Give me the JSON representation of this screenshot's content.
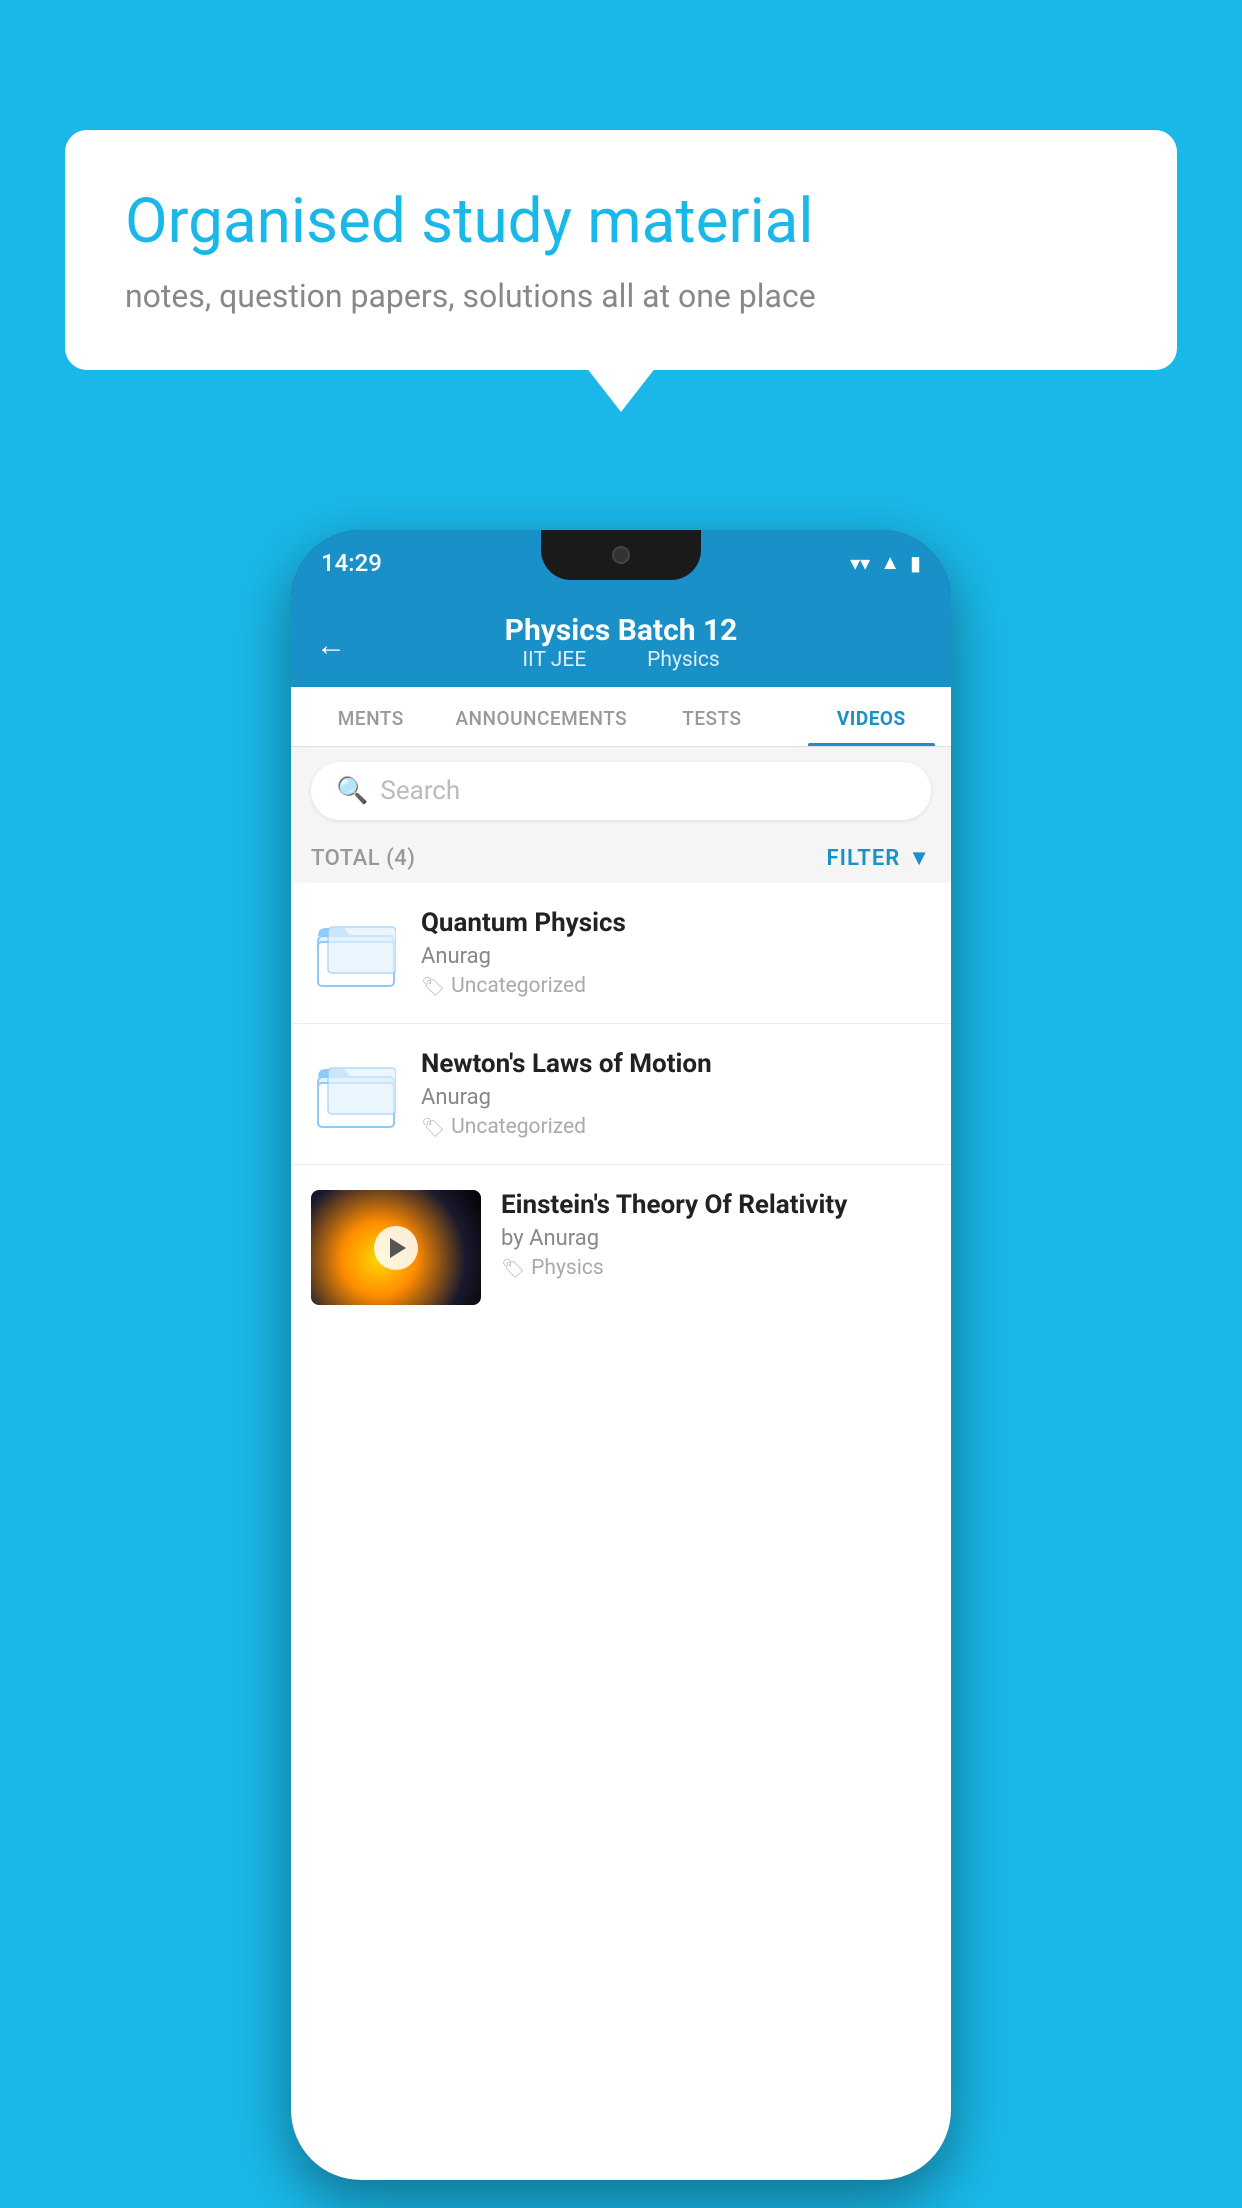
{
  "bubble": {
    "title": "Organised study material",
    "subtitle": "notes, question papers, solutions all at one place"
  },
  "status_bar": {
    "time": "14:29",
    "wifi_icon": "▾",
    "signal_icon": "◂▲",
    "battery_icon": "▮"
  },
  "header": {
    "back_label": "←",
    "title": "Physics Batch 12",
    "tag1": "IIT JEE",
    "tag2": "Physics"
  },
  "tabs": [
    {
      "label": "MENTS",
      "active": false
    },
    {
      "label": "ANNOUNCEMENTS",
      "active": false
    },
    {
      "label": "TESTS",
      "active": false
    },
    {
      "label": "VIDEOS",
      "active": true
    }
  ],
  "search": {
    "placeholder": "Search"
  },
  "filter_row": {
    "total_label": "TOTAL (4)",
    "filter_label": "FILTER"
  },
  "videos": [
    {
      "title": "Quantum Physics",
      "author": "Anurag",
      "tag": "Uncategorized",
      "has_thumb": false
    },
    {
      "title": "Newton's Laws of Motion",
      "author": "Anurag",
      "tag": "Uncategorized",
      "has_thumb": false
    },
    {
      "title": "Einstein's Theory Of Relativity",
      "author": "by Anurag",
      "tag": "Physics",
      "has_thumb": true
    }
  ]
}
